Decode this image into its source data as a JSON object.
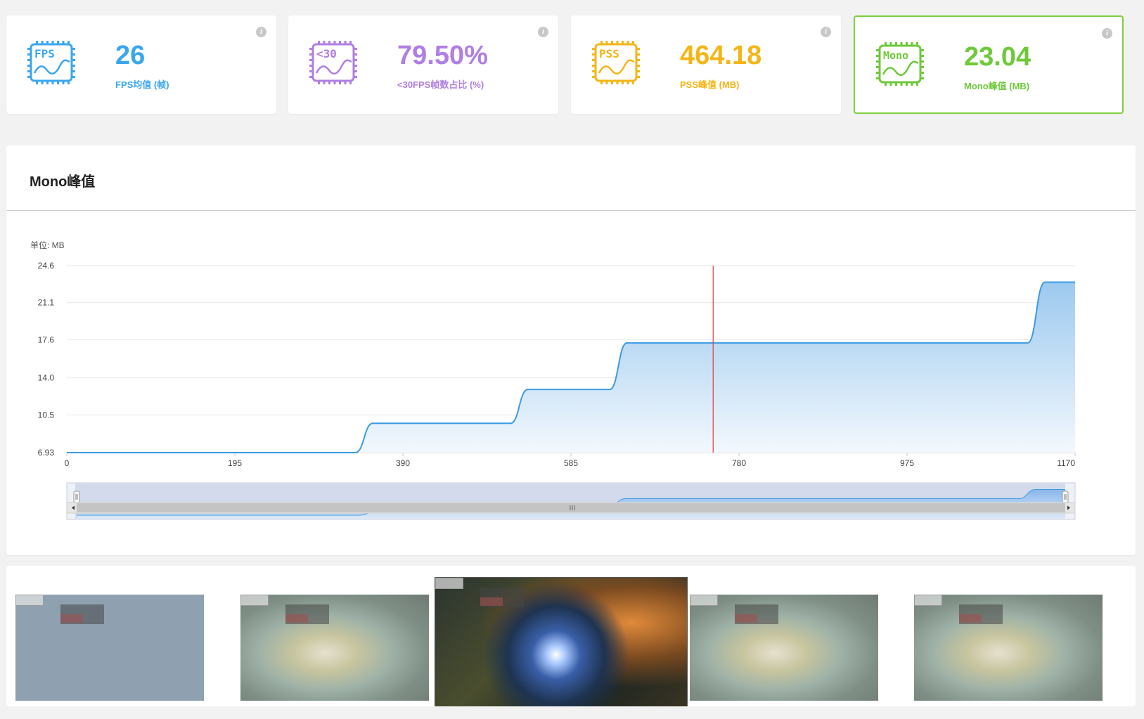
{
  "cards": [
    {
      "icon": "fps-chip-icon",
      "icon_text": "FPS",
      "value": "26",
      "label": "FPS均值 (帧)",
      "color": "#3aa6f0"
    },
    {
      "icon": "under30-chip-icon",
      "icon_text": "<30",
      "value": "79.50%",
      "label": "<30FPS帧数占比 (%)",
      "color": "#b07ee6"
    },
    {
      "icon": "pss-chip-icon",
      "icon_text": "PSS",
      "value": "464.18",
      "label": "PSS峰值 (MB)",
      "color": "#f4b515"
    },
    {
      "icon": "mono-chip-icon",
      "icon_text": "Mono",
      "value": "23.04",
      "label": "Mono峰值 (MB)",
      "color": "#6fc93a",
      "selected": true
    }
  ],
  "info_glyph": "i",
  "panel": {
    "title": "Mono峰值"
  },
  "chart_data": {
    "type": "area",
    "title": "Mono峰值",
    "unit_label": "单位: MB",
    "xlim": [
      0,
      1170
    ],
    "ylim": [
      6.93,
      24.6
    ],
    "x_ticks": [
      0,
      195,
      390,
      585,
      780,
      975,
      1170
    ],
    "y_ticks": [
      "6.93",
      "10.5",
      "14.0",
      "17.6",
      "21.1",
      "24.6"
    ],
    "series": [
      {
        "points": [
          [
            0,
            6.93
          ],
          [
            335,
            6.93
          ],
          [
            355,
            9.7
          ],
          [
            515,
            9.7
          ],
          [
            535,
            12.9
          ],
          [
            630,
            12.9
          ],
          [
            650,
            17.3
          ],
          [
            1115,
            17.3
          ],
          [
            1135,
            23.04
          ],
          [
            1170,
            23.04
          ]
        ]
      }
    ],
    "marker_x": 750,
    "colors": {
      "line": "#3a9be3",
      "fill_top": "#9cc9ef",
      "fill_bottom": "#f3f8fd",
      "marker": "#e23a3a",
      "grid": "#e6e6e6"
    },
    "grid": true,
    "zoom_slider": {
      "start": 0,
      "end": 1170
    }
  },
  "gallery": [
    {
      "name": "screenshot-1",
      "style": "blank"
    },
    {
      "name": "screenshot-2",
      "style": "faded"
    },
    {
      "name": "screenshot-3",
      "style": "vivid",
      "selected": true
    },
    {
      "name": "screenshot-4",
      "style": "faded"
    },
    {
      "name": "screenshot-5",
      "style": "faded"
    }
  ]
}
